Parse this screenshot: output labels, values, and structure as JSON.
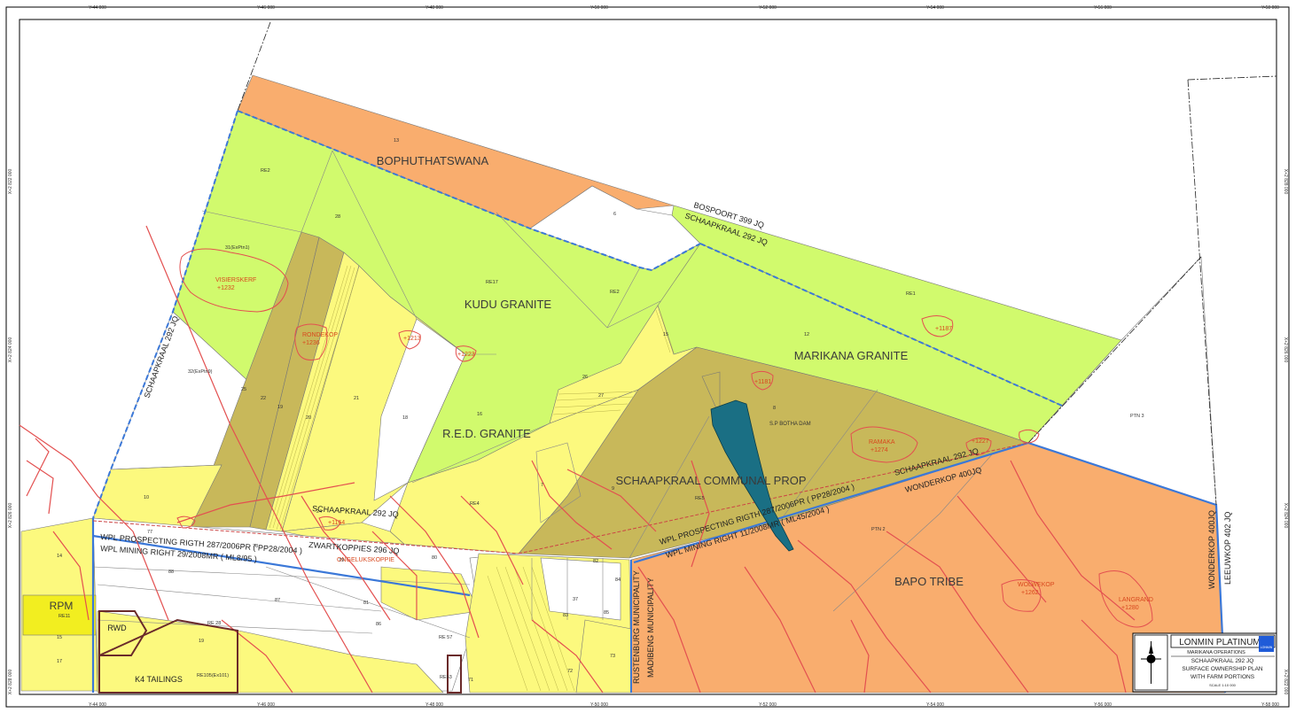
{
  "grid": {
    "top": [
      "Y-44 000",
      "Y-46 000",
      "Y-48 000",
      "Y-50 000",
      "Y-52 000",
      "Y-54 000",
      "Y-56 000",
      "Y-58 000"
    ],
    "bottom": [
      "Y-44 000",
      "Y-46 000",
      "Y-48 000",
      "Y-50 000",
      "Y-52 000",
      "Y-54 000",
      "Y-56 000",
      "Y-58 000"
    ],
    "left": [
      "X+2 822 000",
      "X+2 824 000",
      "X+2 826 000",
      "X+2 828 000"
    ],
    "right": [
      "X+2 828 000",
      "X+2 826 000",
      "X+2 824 000",
      "X+2 822 000"
    ]
  },
  "regions": {
    "bophuthatswana": "BOPHUTHATSWANA",
    "kudu_granite": "KUDU GRANITE",
    "marikana_granite": "MARIKANA GRANITE",
    "red_granite": "R.E.D. GRANITE",
    "schaapkraal_communal": "SCHAAPKRAAL COMMUNAL PROP",
    "bapo_tribe": "BAPO TRIBE",
    "rpm": "RPM",
    "rwd": "RWD",
    "k4_tailings": "K4 TAILINGS"
  },
  "farms": {
    "bospoort": "BOSPOORT 399 JQ",
    "schaapkraal_ne": "SCHAAPKRAAL 292 JQ",
    "schaapkraal_w": "SCHAAPKRAAL 292 JQ",
    "schaapkraal_s": "SCHAAPKRAAL 292 JQ",
    "schaapkraal_se": "SCHAAPKRAAL 292 JQ",
    "zwartkoppies": "ZWARTKOPPIES 296 JQ",
    "wonderkop_e": "WONDERKOP 400JQ",
    "wonderkop_v": "WONDERKOP 400JQ",
    "leeuwkop": "LEEUWKOP 402 JQ"
  },
  "rights": {
    "prospect_w": "WPL PROSPECTING RIGTH 287/2006PR ( PP28/2004 )",
    "mining_w": "WPL MINING RIGHT 29/2008MR ( ML8/95 )",
    "prospect_e": "WPL PROSPECTING RIGTH 287/2006PR ( PP28/2004 )",
    "mining_e": "WPL MINING RIGHT 11/2008MR ( ML45/2004 )"
  },
  "municipalities": {
    "rustenburg": "RUSTENBURG MUNICIPALITY",
    "madibeng": "MADIBENG MUNICIPALITY"
  },
  "hills": {
    "visierskerf": "VISIERSKERF",
    "visierskerf_h": "+1232",
    "rondekop": "RONDEKOP",
    "rondekop_h": "+1236",
    "h1213": "+1213",
    "h1223": "+1223",
    "h1187": "+1187",
    "h1181": "+1181",
    "ramaka": "RAMAKA",
    "ramaka_h": "+1274",
    "h1227": "+1227",
    "h1164": "+1164",
    "ongeluk": "ONGELUKSKOPPIE",
    "wolwekop": "WOLWEKOP",
    "wolwekop_h": "+1262",
    "langrand": "LANGRAND",
    "langrand_h": "+1280"
  },
  "dam": "S.P BOTHA DAM",
  "portions": {
    "p13": "13",
    "re2_top": "RE2",
    "p6": "6",
    "p28": "28",
    "p31": "31(ExPtn1)",
    "re17": "RE17",
    "re2_mid": "RE2",
    "re1": "RE1",
    "p12": "12",
    "p15": "15",
    "p26": "26",
    "p27": "27",
    "p32": "32(ExPtn9)",
    "p25": "25",
    "p22": "22",
    "p21": "21",
    "p20": "20",
    "p19": "19",
    "p18": "18",
    "p16": "16",
    "p8": "8",
    "ptn3": "PTN 3",
    "p10": "10",
    "p7": "7",
    "p9": "9",
    "re4": "RE4",
    "re5": "RE5",
    "ptn2": "PTN 2",
    "p24": "24",
    "p14": "14",
    "re11": "RE11",
    "p78": "78",
    "p79": "79",
    "p80": "80",
    "p88": "88",
    "p87": "87",
    "p81": "81",
    "re28": "RE 28",
    "p86": "86",
    "re57": "RE 57",
    "p19b": "19",
    "re105": "RE105(Ex101)",
    "p82": "82",
    "p84": "84",
    "p83": "83",
    "p85": "85",
    "p73": "73",
    "p72": "72",
    "p71": "71",
    "re63": "RE63",
    "p77": "77",
    "p15b": "15",
    "p17": "17",
    "p37": "37"
  },
  "title_block": {
    "company": "LONMIN PLATINUM",
    "operation": "MARIKANA OPERATIONS",
    "farm": "SCHAAPKRAAL 292 JQ",
    "plan": "SURFACE OWNERSHIP PLAN",
    "detail": "WITH FARM PORTIONS",
    "scale": "SCALE 1:10 000",
    "logo": "LONMIN"
  },
  "colors": {
    "orange": "#f9ad6e",
    "green": "#d1fa6d",
    "olive": "#c8b85a",
    "yellow": "#fcf97e",
    "white": "#ffffff",
    "road": "#e35050",
    "boundary_blue": "#3b78d8",
    "dam": "#1a6f84",
    "lonmin_blue": "#1f5bd8"
  }
}
